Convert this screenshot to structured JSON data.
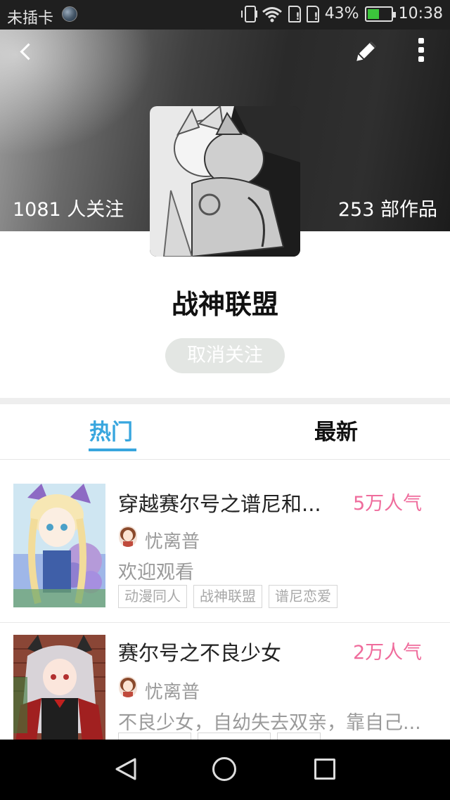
{
  "status_bar": {
    "carrier": "未插卡",
    "battery_percent": "43%",
    "time": "10:38",
    "icons": [
      "globe-icon",
      "vibrate-icon",
      "wifi-icon",
      "sim-icon",
      "sim-icon",
      "battery-icon"
    ]
  },
  "header": {
    "followers": "1081 人关注",
    "works": "253 部作品",
    "icons": [
      "back-icon",
      "edit-icon",
      "more-icon"
    ]
  },
  "group": {
    "name": "战神联盟",
    "unfollow_label": "取消关注"
  },
  "tabs": [
    {
      "label": "热门",
      "active": true
    },
    {
      "label": "最新",
      "active": false
    }
  ],
  "colors": {
    "accent": "#38a6de",
    "popularity": "#ef6c9c"
  },
  "works_list": [
    {
      "title": "穿越赛尔号之谱尼和...",
      "popularity": "5万人气",
      "author": "忧离普",
      "description": "欢迎观看",
      "tags": [
        "动漫同人",
        "战神联盟",
        "谱尼恋爱"
      ]
    },
    {
      "title": "赛尔号之不良少女",
      "popularity": "2万人气",
      "author": "忧离普",
      "description": "不良少女，自幼失去双亲，靠自己...",
      "tags": []
    }
  ],
  "nav_bar": [
    "nav-back-icon",
    "nav-home-icon",
    "nav-recent-icon"
  ]
}
